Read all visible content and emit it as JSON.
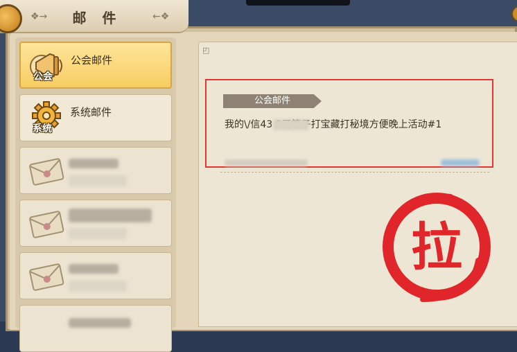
{
  "window": {
    "title": "邮 件"
  },
  "sidebar": {
    "items": [
      {
        "label": "公会邮件",
        "badge": "公会",
        "icon": "megaphone-icon",
        "state": "active"
      },
      {
        "label": "系统邮件",
        "badge": "系统",
        "icon": "gear-icon",
        "state": "normal"
      },
      {
        "label": "",
        "icon": "envelope-icon",
        "state": "redacted"
      },
      {
        "label": "",
        "icon": "envelope-icon",
        "state": "redacted"
      },
      {
        "label": "",
        "icon": "envelope-icon",
        "state": "redacted"
      }
    ]
  },
  "mail": {
    "tag": "公会邮件",
    "body": "我的\\/信43      2开箱子打宝藏打秘境方便晚上活动#1"
  },
  "stamp": {
    "glyph": "拉",
    "color": "#e0262b"
  },
  "colors": {
    "accent": "#f7cd62",
    "highlight_border": "#e2362e"
  }
}
